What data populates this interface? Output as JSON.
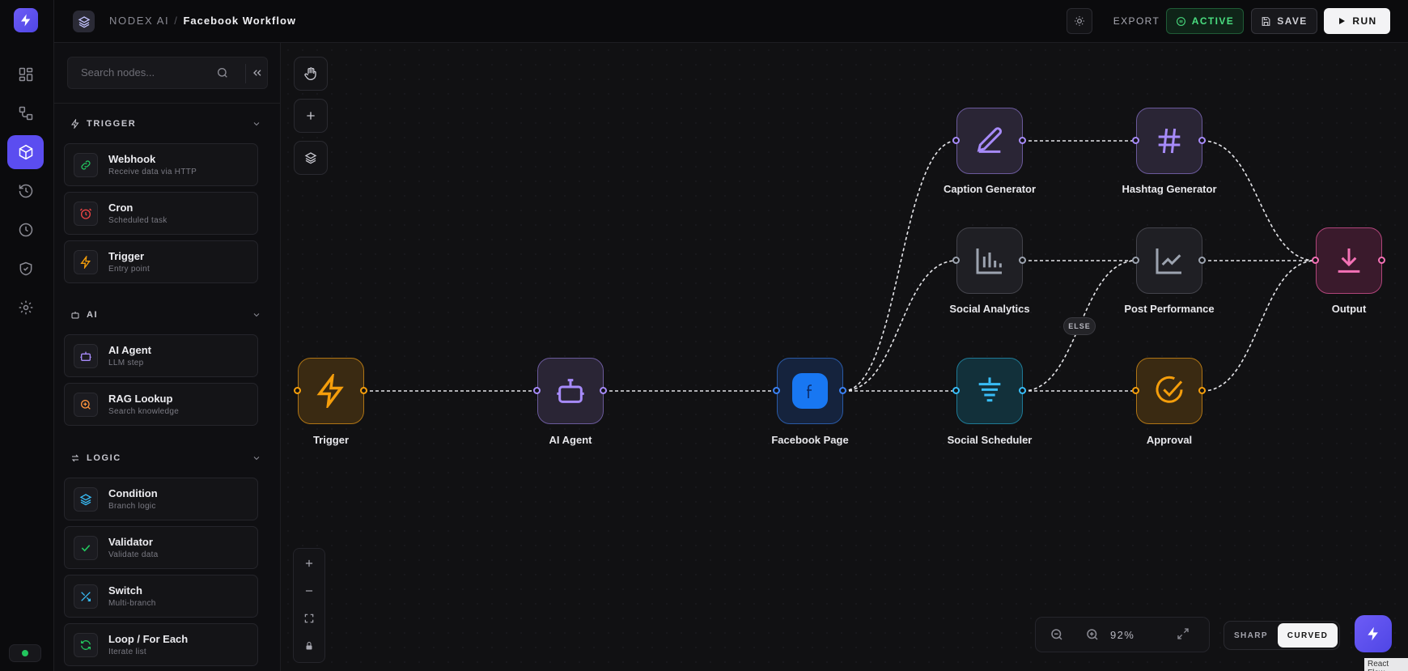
{
  "header": {
    "workspace": "NODEX AI",
    "separator": "/",
    "workflow_name": "Facebook Workflow",
    "export_label": "EXPORT",
    "active_label": "ACTIVE",
    "save_label": "SAVE",
    "run_label": "RUN"
  },
  "sidebar": {
    "search_placeholder": "Search nodes...",
    "sections": [
      {
        "title": "TRIGGER",
        "items": [
          {
            "label": "Webhook",
            "desc": "Receive data via HTTP"
          },
          {
            "label": "Cron",
            "desc": "Scheduled task"
          },
          {
            "label": "Trigger",
            "desc": "Entry point"
          }
        ]
      },
      {
        "title": "AI",
        "items": [
          {
            "label": "AI Agent",
            "desc": "LLM step"
          },
          {
            "label": "RAG Lookup",
            "desc": "Search knowledge"
          }
        ]
      },
      {
        "title": "LOGIC",
        "items": [
          {
            "label": "Condition",
            "desc": "Branch logic"
          },
          {
            "label": "Validator",
            "desc": "Validate data"
          },
          {
            "label": "Switch",
            "desc": "Multi-branch"
          },
          {
            "label": "Loop / For Each",
            "desc": "Iterate list"
          }
        ]
      }
    ]
  },
  "canvas": {
    "nodes": {
      "trigger": "Trigger",
      "ai_agent": "AI Agent",
      "facebook_page": "Facebook Page",
      "caption_generator": "Caption Generator",
      "hashtag_generator": "Hashtag Generator",
      "social_analytics": "Social Analytics",
      "post_performance": "Post Performance",
      "social_scheduler": "Social Scheduler",
      "approval": "Approval",
      "output": "Output"
    },
    "else_label": "ELSE",
    "zoom": "92%",
    "edge_style": {
      "sharp": "SHARP",
      "curved": "CURVED",
      "selected": "CURVED"
    },
    "attribution": "React Flow"
  },
  "colors": {
    "accent": "#5b4df0",
    "active": "#4ade80",
    "trigger": "#f59e0b",
    "ai": "#a78bfa",
    "facebook": "#1877f2",
    "scheduler": "#38bdf8",
    "output": "#f472b6",
    "muted_node": "#9ca3af"
  }
}
